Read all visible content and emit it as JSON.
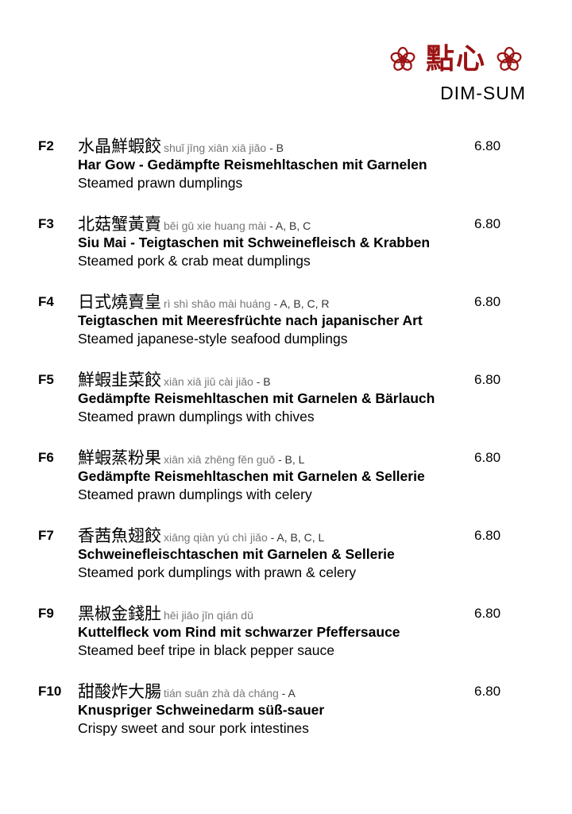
{
  "header": {
    "title_cn": "點心",
    "title_en": "DIM-SUM",
    "accent_color": "#9b1313",
    "decoration_icon": "flower-icon"
  },
  "items": [
    {
      "code": "F2",
      "name_cn": "水晶鮮蝦餃",
      "pinyin": "shuǐ jīng xiān xiā jiǎo",
      "allergens": " - B",
      "name_de": "Har Gow - Gedämpfte Reismehltaschen mit Garnelen",
      "name_en": "Steamed prawn dumplings",
      "price": "6.80"
    },
    {
      "code": "F3",
      "name_cn": "北菇蟹黃賣",
      "pinyin": "běi gū xie huang mài",
      "allergens": " - A, B, C",
      "name_de": "Siu Mai - Teigtaschen mit Schweinefleisch & Krabben",
      "name_en": "Steamed pork & crab meat dumplings",
      "price": "6.80"
    },
    {
      "code": "F4",
      "name_cn": "日式燒賣皇",
      "pinyin": "rì shì shāo mài huáng",
      "allergens": "  - A, B, C, R",
      "name_de": "Teigtaschen mit Meeresfrüchte nach japanischer Art",
      "name_en": "Steamed japanese-style seafood dumplings",
      "price": "6.80"
    },
    {
      "code": "F5",
      "name_cn": "鮮蝦韭菜餃",
      "pinyin": "xiān xiā jiǔ cài jiǎo",
      "allergens": "  - B",
      "name_de": "Gedämpfte Reismehltaschen mit Garnelen & Bärlauch",
      "name_en": "Steamed prawn dumplings with chives",
      "price": "6.80"
    },
    {
      "code": "F6",
      "name_cn": "鮮蝦蒸粉果",
      "pinyin": "xiān xiā zhēng fěn guǒ",
      "allergens": " - B, L",
      "name_de": "Gedämpfte Reismehltaschen mit Garnelen & Sellerie",
      "name_en": "Steamed prawn dumplings with celery",
      "price": "6.80"
    },
    {
      "code": "F7",
      "name_cn": "香茜魚翅餃",
      "pinyin": "xiāng qiàn yú chì jiǎo",
      "allergens": "  - A, B, C, L",
      "name_de": "Schweinefleischtaschen mit Garnelen & Sellerie",
      "name_en": "Steamed pork dumplings with prawn & celery",
      "price": "6.80"
    },
    {
      "code": "F9",
      "name_cn": "黑椒金錢肚",
      "pinyin": "hēi jiāo jīn qián dǔ",
      "allergens": "",
      "name_de": "Kuttelfleck vom Rind mit schwarzer Pfeffersauce",
      "name_en": "Steamed beef tripe in black pepper sauce",
      "price": "6.80"
    },
    {
      "code": "F10",
      "name_cn": "甜酸炸大腸",
      "pinyin": "tián suān zhà dà cháng",
      "allergens": " - A",
      "name_de": "Knuspriger Schweinedarm süß-sauer",
      "name_en": "Crispy sweet and sour pork intestines",
      "price": "6.80"
    }
  ]
}
